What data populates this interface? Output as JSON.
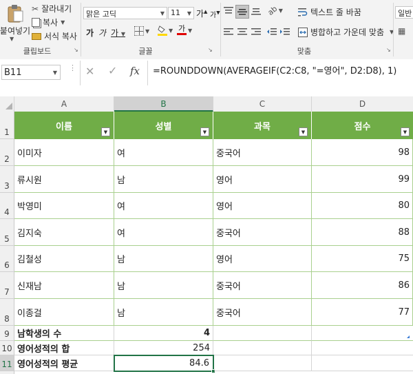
{
  "ribbon": {
    "clipboard": {
      "paste_label": "붙여넣기",
      "cut_label": "잘라내기",
      "copy_label": "복사",
      "format_painter_label": "서식 복사",
      "group_label": "클립보드"
    },
    "font": {
      "font_name": "맑은 고딕",
      "font_size": "11",
      "grow_label": "가",
      "shrink_label": "가",
      "bold_label": "가",
      "italic_label": "가",
      "underline_label": "가",
      "font_color_label": "가",
      "group_label": "글꼴"
    },
    "alignment": {
      "wrap_text_label": "텍스트 줄 바꿈",
      "merge_center_label": "병합하고 가운데 맞춤",
      "group_label": "맞춤"
    },
    "number": {
      "format_value": "일반"
    }
  },
  "formula_bar": {
    "name_box": "B11",
    "fx_label": "fx",
    "formula": "=ROUNDDOWN(AVERAGEIF(C2:C8, \"=영어\", D2:D8), 1)"
  },
  "sheet": {
    "columns": [
      "A",
      "B",
      "C",
      "D"
    ],
    "selected_column": "B",
    "selected_row": "11",
    "row_numbers": [
      "1",
      "2",
      "3",
      "4",
      "5",
      "6",
      "7",
      "8",
      "9",
      "10",
      "11"
    ],
    "headers": [
      "이름",
      "성별",
      "과목",
      "점수"
    ],
    "rows": [
      {
        "name": "이미자",
        "gender": "여",
        "subject": "중국어",
        "score": "98"
      },
      {
        "name": "류시원",
        "gender": "남",
        "subject": "영어",
        "score": "99"
      },
      {
        "name": "박영미",
        "gender": "여",
        "subject": "영어",
        "score": "80"
      },
      {
        "name": "김지숙",
        "gender": "여",
        "subject": "중국어",
        "score": "88"
      },
      {
        "name": "김철성",
        "gender": "남",
        "subject": "영어",
        "score": "75"
      },
      {
        "name": "신재남",
        "gender": "남",
        "subject": "중국어",
        "score": "86"
      },
      {
        "name": "이종걸",
        "gender": "남",
        "subject": "중국어",
        "score": "77"
      }
    ],
    "summary": [
      {
        "label": "남학생의 수",
        "value": "4"
      },
      {
        "label": "영어성적의 합",
        "value": "254"
      },
      {
        "label": "영어성적의 평균",
        "value": "84.6"
      }
    ],
    "colors": {
      "header_fill": "#70ad47",
      "table_border": "#a9d08e",
      "selection": "#217346"
    }
  }
}
